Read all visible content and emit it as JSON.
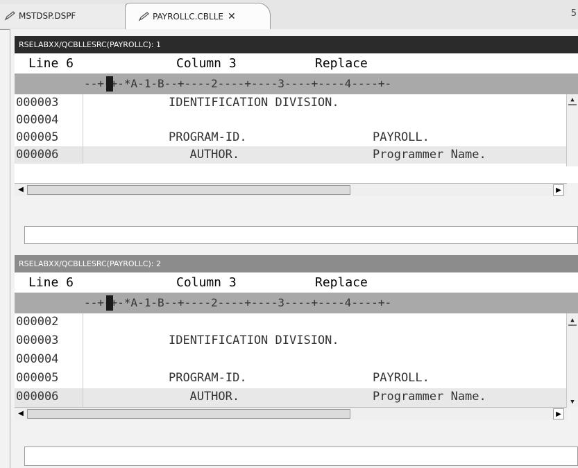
{
  "tabs": [
    {
      "label": "MSTDSP.DSPF",
      "active": false
    },
    {
      "label": "PAYROLLC.CBLLE",
      "active": true
    }
  ],
  "tab_close_label": "✕",
  "tab_overflow_label": "5",
  "panes": [
    {
      "title": "RSELABXX/QCBLLESRC(PAYROLLC): 1",
      "status": {
        "line": "Line 6",
        "column": "Column 3",
        "mode": "Replace"
      },
      "ruler": "--+-+-*A-1-B--+----2----+----3----+----4----+-",
      "rows": [
        {
          "num": "000003",
          "col1": "IDENTIFICATION DIVISION.",
          "col2": ""
        },
        {
          "num": "000004",
          "col1": "",
          "col2": ""
        },
        {
          "num": "000005",
          "col1": "PROGRAM-ID.",
          "col2": "PAYROLL."
        },
        {
          "num": "000006",
          "col1": "  AUTHOR.",
          "col2": "Programmer Name."
        }
      ]
    },
    {
      "title": "RSELABXX/QCBLLESRC(PAYROLLC): 2",
      "status": {
        "line": "Line 6",
        "column": "Column 3",
        "mode": "Replace"
      },
      "ruler": "--+-+-*A-1-B--+----2----+----3----+----4----+-",
      "rows": [
        {
          "num": "000002",
          "col1": "",
          "col2": ""
        },
        {
          "num": "000003",
          "col1": "IDENTIFICATION DIVISION.",
          "col2": ""
        },
        {
          "num": "000004",
          "col1": "",
          "col2": ""
        },
        {
          "num": "000005",
          "col1": "PROGRAM-ID.",
          "col2": "PAYROLL."
        },
        {
          "num": "000006",
          "col1": "  AUTHOR.",
          "col2": "Programmer Name."
        }
      ]
    }
  ],
  "colors": {
    "active_title": "#2b2b2b",
    "inactive_title": "#8c8c8c",
    "ruler": "#a9a9a9",
    "current_line": "#e8e8e8"
  }
}
